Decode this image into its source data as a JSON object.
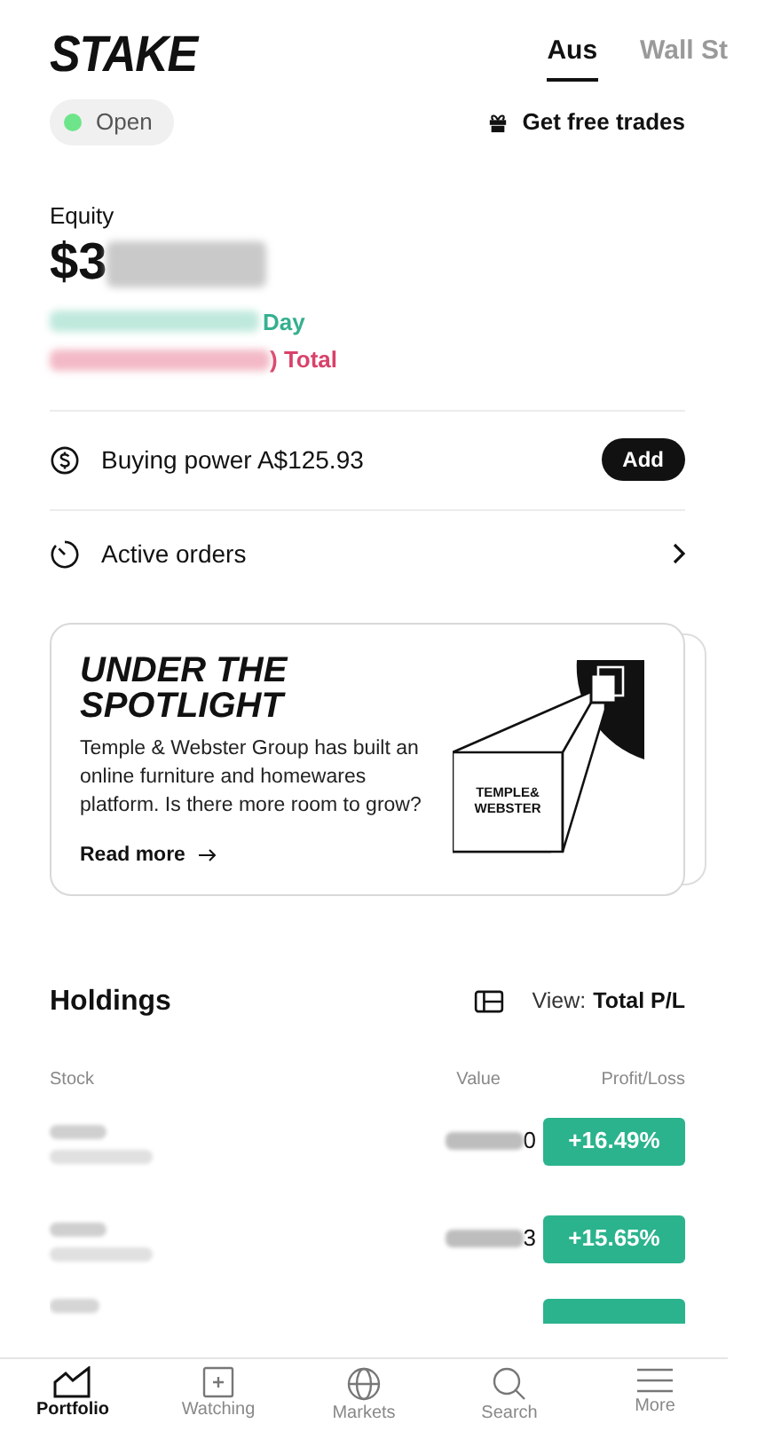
{
  "header": {
    "logo": "STAKE",
    "tabs": [
      {
        "label": "Aus",
        "selected": true
      },
      {
        "label": "Wall St",
        "selected": false
      }
    ]
  },
  "market_status": {
    "label": "Open",
    "open": true
  },
  "promo_link": "Get free trades",
  "equity": {
    "label": "Equity",
    "value_visible": "$3",
    "day_suffix": "Day",
    "total_suffix": ") Total"
  },
  "buying_power": {
    "label": "Buying power A$125.93",
    "button": "Add"
  },
  "active_orders": {
    "label": "Active orders"
  },
  "spotlight": {
    "title": "UNDER THE SPOTLIGHT",
    "body": "Temple & Webster Group has built an online furniture and homewares platform. Is there more room to grow?",
    "link": "Read more",
    "logo_line_1": "TEMPLE&",
    "logo_line_2": "WEBSTER"
  },
  "holdings": {
    "title": "Holdings",
    "view_label": "View:",
    "view_value": "Total P/L",
    "columns": [
      "Stock",
      "Value",
      "Profit/Loss"
    ],
    "rows": [
      {
        "value_visible": "0",
        "profit": "+16.49%",
        "kind": "gain"
      },
      {
        "value_visible": "3",
        "profit": "+15.65%",
        "kind": "gain"
      }
    ]
  },
  "nav": [
    {
      "label": "Portfolio",
      "selected": true
    },
    {
      "label": "Watching",
      "selected": false
    },
    {
      "label": "Markets",
      "selected": false
    },
    {
      "label": "Search",
      "selected": false
    },
    {
      "label": "More",
      "selected": false
    }
  ]
}
